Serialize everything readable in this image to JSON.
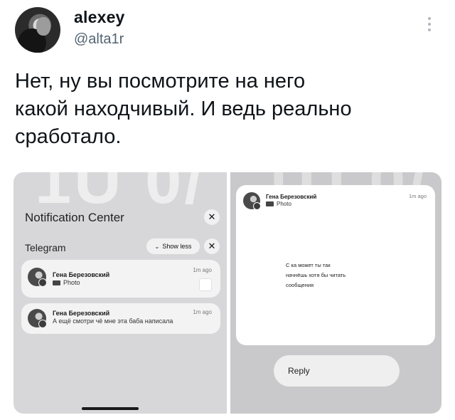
{
  "tweet": {
    "display_name": "alexey",
    "handle": "@alta1r",
    "text_lines": [
      "Нет, ну вы посмотрите на него",
      "какой находчивый. И ведь реально",
      "сработало."
    ],
    "avatar_icon": "user-avatar",
    "more_icon": "vertical-ellipsis-icon"
  },
  "left_screen": {
    "clock_fragment": "1Ü 0/",
    "title": "Notification Center",
    "close_glyph": "✕",
    "group_name": "Telegram",
    "show_less_label": "Show less",
    "show_less_glyph": "⌄",
    "group_close_glyph": "✕",
    "notifications": [
      {
        "sender": "Гена Березовский",
        "time": "1m ago",
        "body": "Photo",
        "has_camera_icon": true,
        "has_thumbnail": true
      },
      {
        "sender": "Гена Березовский",
        "time": "1m ago",
        "body": "А ещё смотри чё мне эта баба написала",
        "has_camera_icon": false,
        "has_thumbnail": false
      }
    ]
  },
  "right_screen": {
    "clock_fragment": "1Ü 0/",
    "notification": {
      "sender": "Гена Березовский",
      "time": "1m ago",
      "body": "Photo"
    },
    "message_lines": [
      "С  ка может ты так",
      "начнёшь хотя бы читать",
      "сообщения"
    ],
    "reply_label": "Reply"
  }
}
